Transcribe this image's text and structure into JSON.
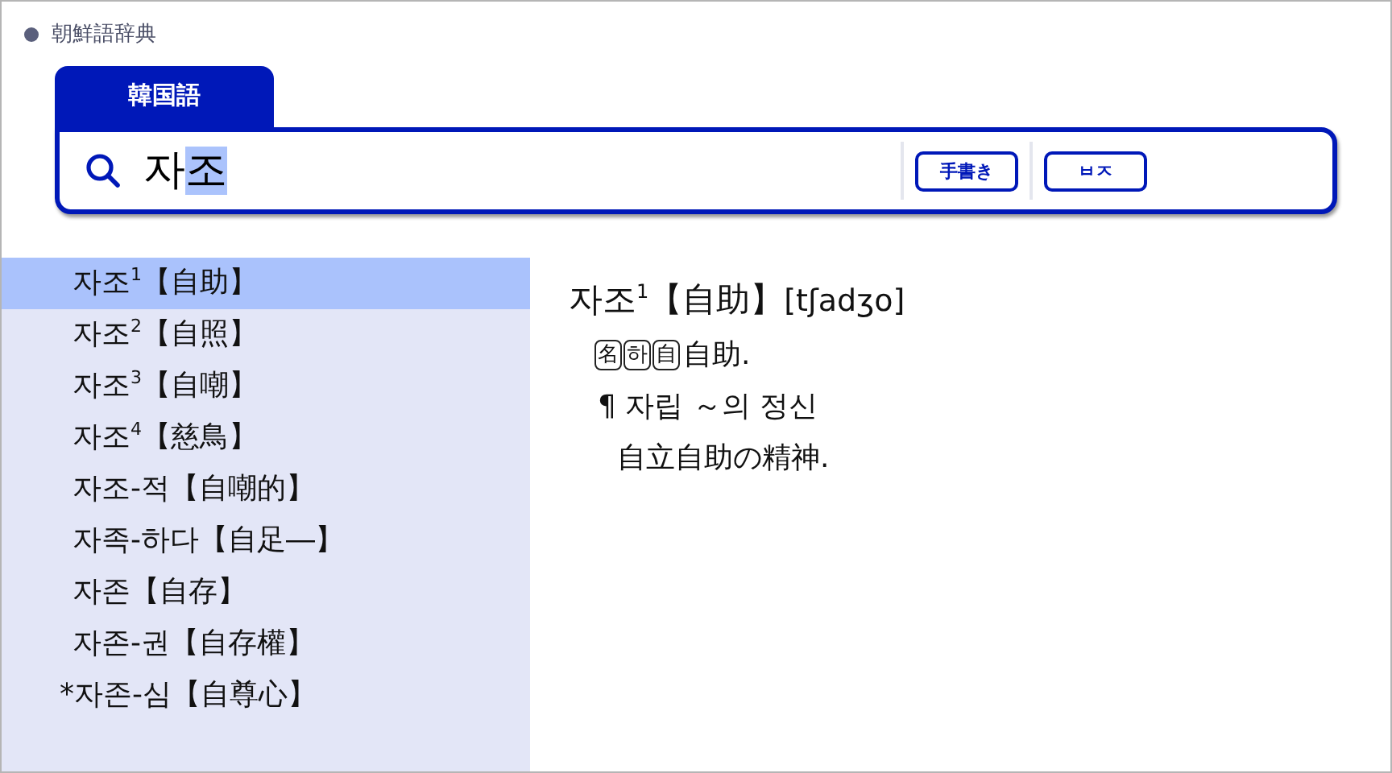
{
  "app": {
    "title": "朝鮮語辞典"
  },
  "tabs": [
    {
      "label": "韓国語",
      "selected": true
    }
  ],
  "search": {
    "value": "자",
    "composing": "조",
    "buttons": [
      "手書き",
      "ㅂㅈ"
    ]
  },
  "results": [
    {
      "label": "자조$^{1}$【自助】",
      "selected": true
    },
    {
      "label": "자조$^{2}$【自照】",
      "selected": false
    },
    {
      "label": "자조$^{3}$【自嘲】",
      "selected": false
    },
    {
      "label": "자조$^{4}$【慈鳥】",
      "selected": false
    },
    {
      "label": "자조-적【自嘲的】",
      "selected": false
    },
    {
      "label": "자족-하다【自足―】",
      "selected": false
    },
    {
      "label": "자존【自存】",
      "selected": false
    },
    {
      "label": "자존-권【自存權】",
      "selected": false
    },
    {
      "label": "*자존-심【自尊心】",
      "selected": false
    }
  ],
  "entry": {
    "headword": "자조$^{1}$【自助】",
    "pronunciation": "[tʃadʒo]",
    "tags": [
      "名",
      "하",
      "自"
    ],
    "definition": "自助.",
    "example": {
      "mark": "¶",
      "text": "자립 ～의 정신",
      "translation": "自立自助の精神."
    }
  }
}
